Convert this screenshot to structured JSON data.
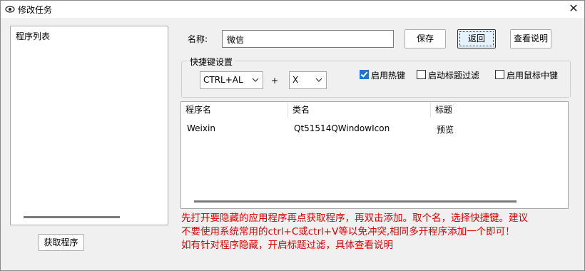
{
  "window": {
    "title": "修改任务",
    "close_symbol": "✕"
  },
  "left_panel": {
    "label": "程序列表",
    "fetch_button": "获取程序"
  },
  "form": {
    "name_label": "名称:",
    "name_value": "微信",
    "save_button": "保存",
    "back_button": "返回",
    "help_button": "查看说明"
  },
  "hotkey": {
    "group_title": "快捷键设置",
    "modifier": "CTRL+AL",
    "plus": "+",
    "key": "X",
    "enable_hotkey": {
      "label": "启用热键",
      "checked": true
    },
    "title_filter": {
      "label": "启动标题过滤",
      "checked": false
    },
    "middle_click": {
      "label": "启用鼠标中键",
      "checked": false
    }
  },
  "table": {
    "columns": [
      "程序名",
      "类名",
      "标题"
    ],
    "rows": [
      [
        "Weixin",
        "Qt51514QWindowIcon",
        "预览"
      ]
    ]
  },
  "info_lines": [
    "先打开要隐藏的应用程序再点获取程序，再双击添加。取个名，选择快捷键。建议",
    "不要使用系统常用的ctrl+C或ctrl+V等以免冲突,相同多开程序添加一个即可！",
    "如有针对程序隐藏，开启标题过滤，具体查看说明"
  ],
  "colors": {
    "accent": "#1f75d1",
    "info_text": "#e00000"
  }
}
